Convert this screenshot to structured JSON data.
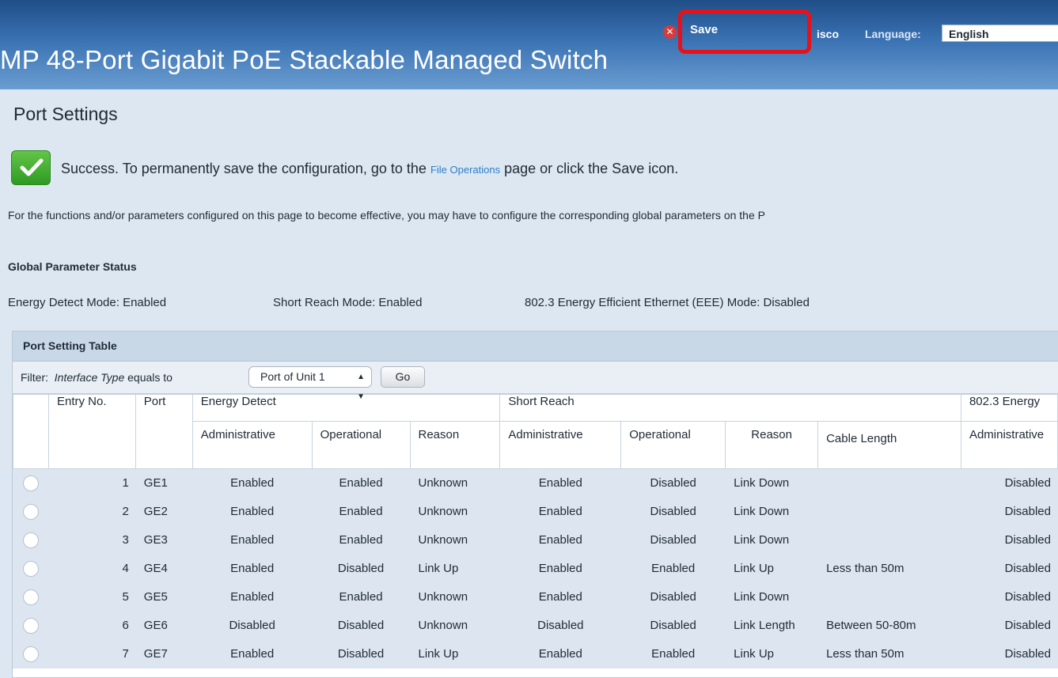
{
  "header": {
    "title": "MP 48-Port Gigabit PoE Stackable Managed Switch",
    "save_label": "Save",
    "username": "isco",
    "language_label": "Language:",
    "language_value": "English"
  },
  "page": {
    "title": "Port Settings",
    "success_text_before": "Success. To permanently save the configuration, go to the ",
    "success_link": "File Operations",
    "success_text_after": " page or click the Save icon.",
    "note": "For the functions and/or parameters configured on this page to become effective, you may have to configure the corresponding global parameters on the P"
  },
  "global_status": {
    "title": "Global Parameter Status",
    "energy_detect": "Energy Detect Mode:  Enabled",
    "short_reach": "Short Reach Mode:  Enabled",
    "eee": "802.3 Energy Efficient Ethernet (EEE) Mode:  Disabled"
  },
  "table": {
    "title": "Port Setting Table",
    "filter_prefix": "Filter:",
    "filter_field": "Interface Type",
    "filter_op": "equals to",
    "filter_value": "Port of Unit 1",
    "go_label": "Go",
    "col_entry": "Entry No.",
    "col_port": "Port",
    "group_energy": "Energy Detect",
    "group_short": "Short Reach",
    "group_eee": "802.3 Energy",
    "sub_admin": "Administrative",
    "sub_oper": "Operational",
    "sub_reason": "Reason",
    "sub_cable": "Cable Length",
    "sub_eee_admin": "Administrative",
    "rows": [
      {
        "entry": "1",
        "port": "GE1",
        "ed_admin": "Enabled",
        "ed_oper": "Enabled",
        "ed_reason": "Unknown",
        "sr_admin": "Enabled",
        "sr_oper": "Disabled",
        "sr_reason": "Link Down",
        "cable": "",
        "eee_admin": "Disabled"
      },
      {
        "entry": "2",
        "port": "GE2",
        "ed_admin": "Enabled",
        "ed_oper": "Enabled",
        "ed_reason": "Unknown",
        "sr_admin": "Enabled",
        "sr_oper": "Disabled",
        "sr_reason": "Link Down",
        "cable": "",
        "eee_admin": "Disabled"
      },
      {
        "entry": "3",
        "port": "GE3",
        "ed_admin": "Enabled",
        "ed_oper": "Enabled",
        "ed_reason": "Unknown",
        "sr_admin": "Enabled",
        "sr_oper": "Disabled",
        "sr_reason": "Link Down",
        "cable": "",
        "eee_admin": "Disabled"
      },
      {
        "entry": "4",
        "port": "GE4",
        "ed_admin": "Enabled",
        "ed_oper": "Disabled",
        "ed_reason": "Link Up",
        "sr_admin": "Enabled",
        "sr_oper": "Enabled",
        "sr_reason": "Link Up",
        "cable": "Less than 50m",
        "eee_admin": "Disabled"
      },
      {
        "entry": "5",
        "port": "GE5",
        "ed_admin": "Enabled",
        "ed_oper": "Enabled",
        "ed_reason": "Unknown",
        "sr_admin": "Enabled",
        "sr_oper": "Disabled",
        "sr_reason": "Link Down",
        "cable": "",
        "eee_admin": "Disabled"
      },
      {
        "entry": "6",
        "port": "GE6",
        "ed_admin": "Disabled",
        "ed_oper": "Disabled",
        "ed_reason": "Unknown",
        "sr_admin": "Disabled",
        "sr_oper": "Disabled",
        "sr_reason": "Link Length",
        "cable": "Between 50-80m",
        "eee_admin": "Disabled"
      },
      {
        "entry": "7",
        "port": "GE7",
        "ed_admin": "Enabled",
        "ed_oper": "Disabled",
        "ed_reason": "Link Up",
        "sr_admin": "Enabled",
        "sr_oper": "Enabled",
        "sr_reason": "Link Up",
        "cable": "Less than 50m",
        "eee_admin": "Disabled"
      }
    ]
  },
  "colors": {
    "header_blue": "#2f64a3",
    "highlight_red": "#e8101a",
    "success_green": "#3fae2f",
    "link_blue": "#2b7ec6"
  }
}
